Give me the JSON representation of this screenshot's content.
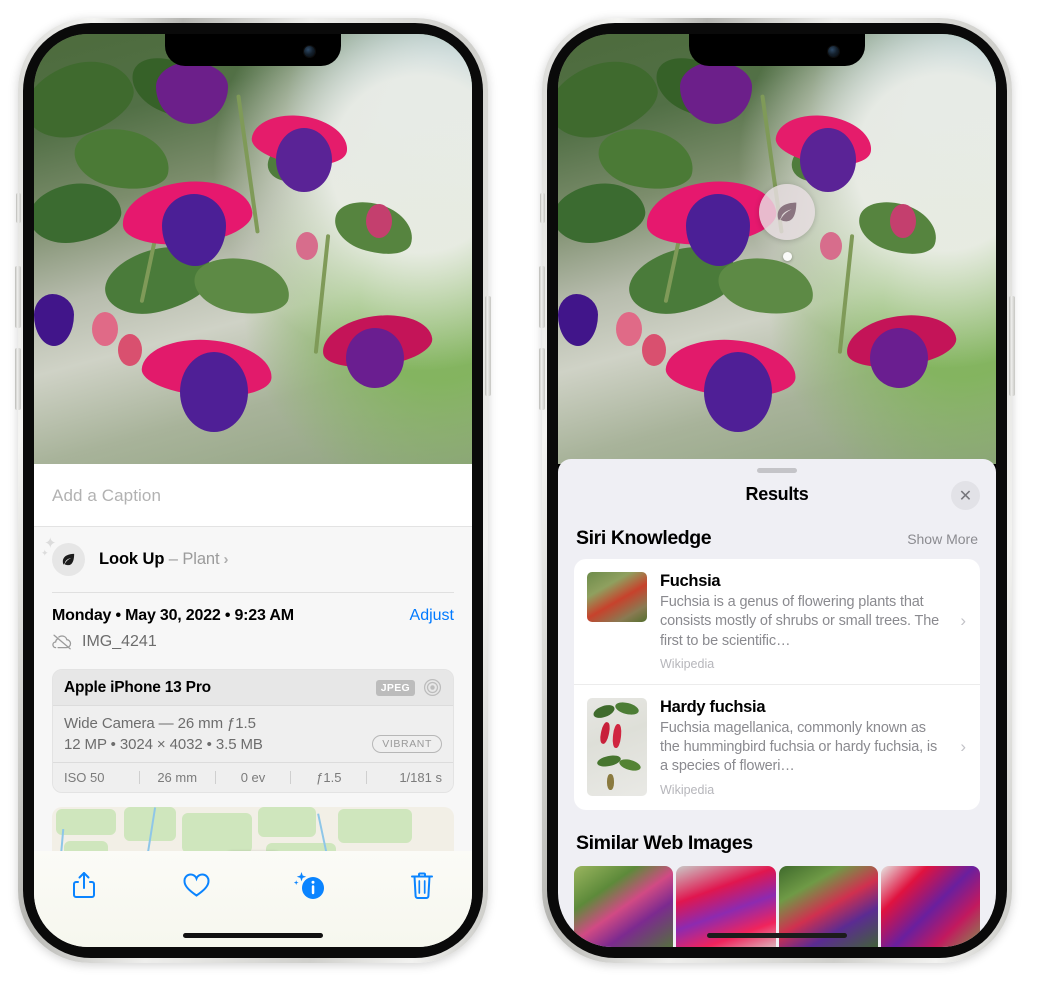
{
  "left_phone": {
    "photo": {
      "alt_name": "fuchsia-plant-photo"
    },
    "caption": {
      "placeholder": "Add a Caption",
      "value": ""
    },
    "look_up": {
      "icon": "leaf-icon",
      "label": "Look Up",
      "dash": " – ",
      "subject": "Plant",
      "chevron": "›"
    },
    "meta": {
      "date": "Monday • May 30, 2022 • 9:23 AM",
      "adjust_label": "Adjust",
      "cloud_icon": "cloud-slash-icon",
      "filename": "IMG_4241"
    },
    "camera_card": {
      "model": "Apple iPhone 13 Pro",
      "format_badge": "JPEG",
      "aperture_icon": "aperture-icon",
      "lens": "Wide Camera — 26 mm ƒ1.5",
      "spec": "12 MP • 3024 × 4032 • 3.5 MB",
      "style_badge": "VIBRANT",
      "exif": [
        "ISO 50",
        "26 mm",
        "0 ev",
        "ƒ1.5",
        "1/181 s"
      ]
    },
    "toolbar": {
      "share_label": "share-icon",
      "favorite_label": "heart-icon",
      "info_label": "info-sparkle-icon",
      "delete_label": "trash-icon"
    },
    "colors": {
      "accent": "#007aff",
      "sheet_bg": "#f7f7f7",
      "toolbar_bg": "#f6f7ee"
    }
  },
  "right_phone": {
    "visual_lookup_badge": {
      "icon": "leaf-icon"
    },
    "sheet": {
      "title": "Results",
      "close_label": "✕",
      "sections": [
        {
          "title": "Siri Knowledge",
          "action": "Show More",
          "items": [
            {
              "name": "Fuchsia",
              "description": "Fuchsia is a genus of flowering plants that consists mostly of shrubs or small trees. The first to be scientific…",
              "source": "Wikipedia",
              "chevron": "›"
            },
            {
              "name": "Hardy fuchsia",
              "description": "Fuchsia magellanica, commonly known as the hummingbird fuchsia or hardy fuchsia, is a species of floweri…",
              "source": "Wikipedia",
              "chevron": "›"
            }
          ]
        },
        {
          "title": "Similar Web Images",
          "thumbnails": [
            "fuchsia-web-image-1",
            "fuchsia-web-image-2",
            "fuchsia-web-image-3",
            "fuchsia-web-image-4"
          ]
        }
      ]
    },
    "colors": {
      "sheet_bg": "#efeff4",
      "card_bg": "#ffffff"
    }
  }
}
